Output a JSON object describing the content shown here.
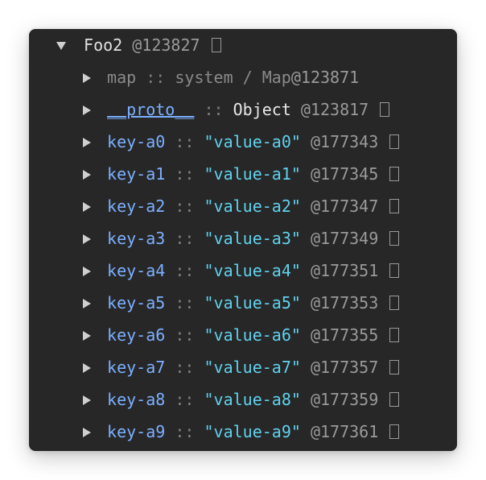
{
  "root": {
    "name": "Foo2",
    "addr": "@123827"
  },
  "map_row": {
    "key": "map",
    "sep": "::",
    "type": "system / Map",
    "addr": "@123871"
  },
  "proto_row": {
    "key": "__proto__",
    "sep": "::",
    "type": "Object",
    "addr": "@123817"
  },
  "entries": [
    {
      "key": "key-a0",
      "sep": "::",
      "value": "\"value-a0\"",
      "addr": "@177343"
    },
    {
      "key": "key-a1",
      "sep": "::",
      "value": "\"value-a1\"",
      "addr": "@177345"
    },
    {
      "key": "key-a2",
      "sep": "::",
      "value": "\"value-a2\"",
      "addr": "@177347"
    },
    {
      "key": "key-a3",
      "sep": "::",
      "value": "\"value-a3\"",
      "addr": "@177349"
    },
    {
      "key": "key-a4",
      "sep": "::",
      "value": "\"value-a4\"",
      "addr": "@177351"
    },
    {
      "key": "key-a5",
      "sep": "::",
      "value": "\"value-a5\"",
      "addr": "@177353"
    },
    {
      "key": "key-a6",
      "sep": "::",
      "value": "\"value-a6\"",
      "addr": "@177355"
    },
    {
      "key": "key-a7",
      "sep": "::",
      "value": "\"value-a7\"",
      "addr": "@177357"
    },
    {
      "key": "key-a8",
      "sep": "::",
      "value": "\"value-a8\"",
      "addr": "@177359"
    },
    {
      "key": "key-a9",
      "sep": "::",
      "value": "\"value-a9\"",
      "addr": "@177361"
    }
  ],
  "icons": {
    "expanded": "triangle-down-icon",
    "collapsed": "triangle-right-icon",
    "reveal": "reveal-in-summary-icon"
  }
}
